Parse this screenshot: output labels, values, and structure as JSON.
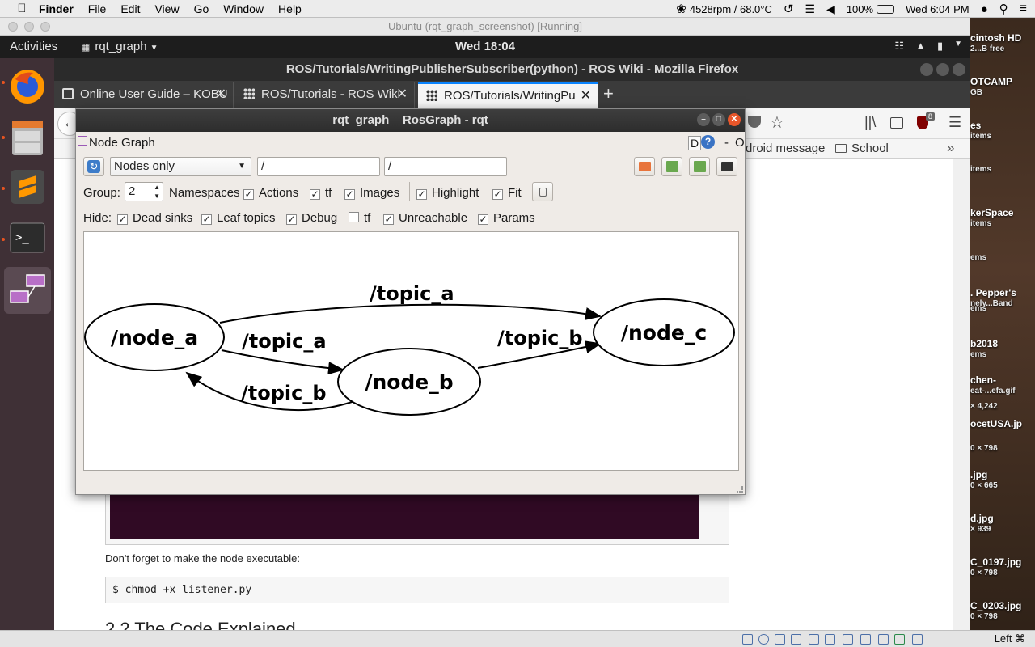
{
  "mac_menubar": {
    "app": "Finder",
    "menus": [
      "File",
      "Edit",
      "View",
      "Go",
      "Window",
      "Help"
    ],
    "fan_status": "4528rpm / 68.0°C",
    "battery": "100%",
    "datetime": "Wed 6:04 PM"
  },
  "vbox": {
    "title": "Ubuntu (rqt_graph_screenshot) [Running]",
    "host_key": "Left ⌘"
  },
  "ubuntu": {
    "activities": "Activities",
    "app_menu": "rqt_graph",
    "clock": "Wed 18:04"
  },
  "firefox": {
    "window_title": "ROS/Tutorials/WritingPublisherSubscriber(python) - ROS Wiki - Mozilla Firefox",
    "tabs": [
      {
        "label": "Online User Guide – KOBU"
      },
      {
        "label": "ROS/Tutorials - ROS Wiki"
      },
      {
        "label": "ROS/Tutorials/WritingPu"
      }
    ],
    "ublock_count": "8",
    "bookmarks": [
      "droid message",
      "School"
    ],
    "page": {
      "note": "Don't forget to make the node executable:",
      "code": "$ chmod +x listener.py",
      "heading": "2.2 The Code Explained"
    }
  },
  "rqt": {
    "title": "rqt_graph__RosGraph - rqt",
    "plugin_title": "Node Graph",
    "plugin_controls": [
      "D",
      "-",
      "O"
    ],
    "graph_type": "Nodes only",
    "ns_filter": "/",
    "topic_filter": "/",
    "group_label": "Group:",
    "group_value": "2",
    "group_options": [
      {
        "label": "Namespaces",
        "checked": false
      },
      {
        "label": "Actions",
        "checked": true
      },
      {
        "label": "tf",
        "checked": true
      },
      {
        "label": "Images",
        "checked": true
      },
      {
        "label": "Highlight",
        "checked": true
      },
      {
        "label": "Fit",
        "checked": true
      }
    ],
    "hide_label": "Hide:",
    "hide_options": [
      {
        "label": "Dead sinks",
        "checked": true
      },
      {
        "label": "Leaf topics",
        "checked": true
      },
      {
        "label": "Debug",
        "checked": true
      },
      {
        "label": "tf",
        "checked": false
      },
      {
        "label": "Unreachable",
        "checked": true
      },
      {
        "label": "Params",
        "checked": true
      }
    ],
    "graph": {
      "nodes": [
        "/node_a",
        "/node_b",
        "/node_c"
      ],
      "edges": [
        {
          "from": "/node_a",
          "to": "/node_c",
          "label": "/topic_a"
        },
        {
          "from": "/node_a",
          "to": "/node_b",
          "label": "/topic_a"
        },
        {
          "from": "/node_b",
          "to": "/node_c",
          "label": "/topic_b"
        },
        {
          "from": "/node_b",
          "to": "/node_a",
          "label": "/topic_b"
        }
      ]
    }
  },
  "desktop_items": [
    {
      "name": "cintosh HD",
      "sub": "2...B free"
    },
    {
      "name": "OTCAMP",
      "sub": "GB"
    },
    {
      "name": "es",
      "sub": "items"
    },
    {
      "name": "",
      "sub": "items"
    },
    {
      "name": "kerSpace",
      "sub": "items"
    },
    {
      "name": "",
      "sub": "ems"
    },
    {
      "name": ". Pepper's",
      "sub": "nely...Band"
    },
    {
      "name": "",
      "sub": "ems"
    },
    {
      "name": "b2018",
      "sub": "ems"
    },
    {
      "name": "chen-",
      "sub": "eat-...efa.gif"
    },
    {
      "name": "",
      "sub": "× 4,242"
    },
    {
      "name": "ocetUSA.jp",
      "sub": ""
    },
    {
      "name": "",
      "sub": "0 × 798"
    },
    {
      "name": ".jpg",
      "sub": "0 × 665"
    },
    {
      "name": "d.jpg",
      "sub": "× 939"
    },
    {
      "name": "C_0197.jpg",
      "sub": "0 × 798"
    },
    {
      "name": "C_0203.jpg",
      "sub": "0 × 798"
    }
  ]
}
